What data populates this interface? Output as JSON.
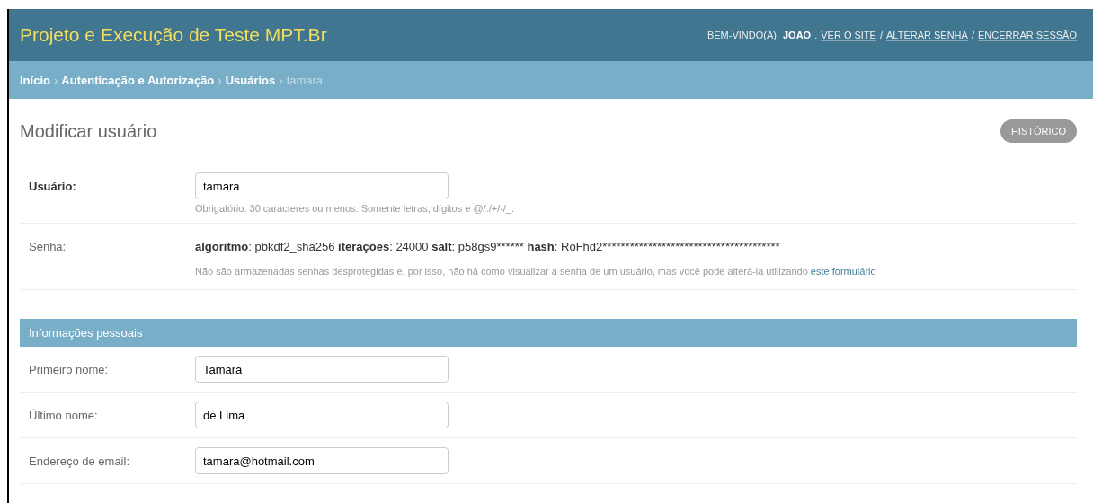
{
  "header": {
    "title": "Projeto e Execução de Teste MPT.Br",
    "welcome": "BEM-VINDO(A),",
    "user": "JOAO",
    "links": [
      {
        "before": ".",
        "label": "VER O SITE"
      },
      {
        "before": "/",
        "label": "ALTERAR SENHA"
      },
      {
        "before": "/",
        "label": "ENCERRAR SESSÃO"
      }
    ]
  },
  "breadcrumbs": {
    "links": [
      "Início",
      "Autenticação e Autorização",
      "Usuários"
    ],
    "separator": "›",
    "current": "tamara"
  },
  "page_title": "Modificar usuário",
  "history_button": "HISTÓRICO",
  "username": {
    "label": "Usuário:",
    "required": true,
    "value": "tamara",
    "help": "Obrigatório. 30 caracteres ou menos. Somente letras, dígitos e @/./+/-/_."
  },
  "password": {
    "label": "Senha:",
    "separator": ":",
    "parts": [
      {
        "key": "algoritmo",
        "value": "pbkdf2_sha256"
      },
      {
        "key": "iterações",
        "value": "24000"
      },
      {
        "key": "salt",
        "value": "p58gs9******"
      },
      {
        "key": "hash",
        "value": "RoFhd2***************************************"
      }
    ],
    "help": "Não são armazenadas senhas desprotegidas e, por isso, não há como visualizar a senha de um usuário, mas você pode alterá-la utilizando",
    "link": "este formulário"
  },
  "personal": {
    "title": "Informações pessoais",
    "fields": [
      {
        "label": "Primeiro nome:",
        "required": false,
        "value": "Tamara"
      },
      {
        "label": "Último nome:",
        "required": false,
        "value": "de Lima"
      },
      {
        "label": "Endereço de email:",
        "required": false,
        "value": "tamara@hotmail.com"
      }
    ]
  }
}
